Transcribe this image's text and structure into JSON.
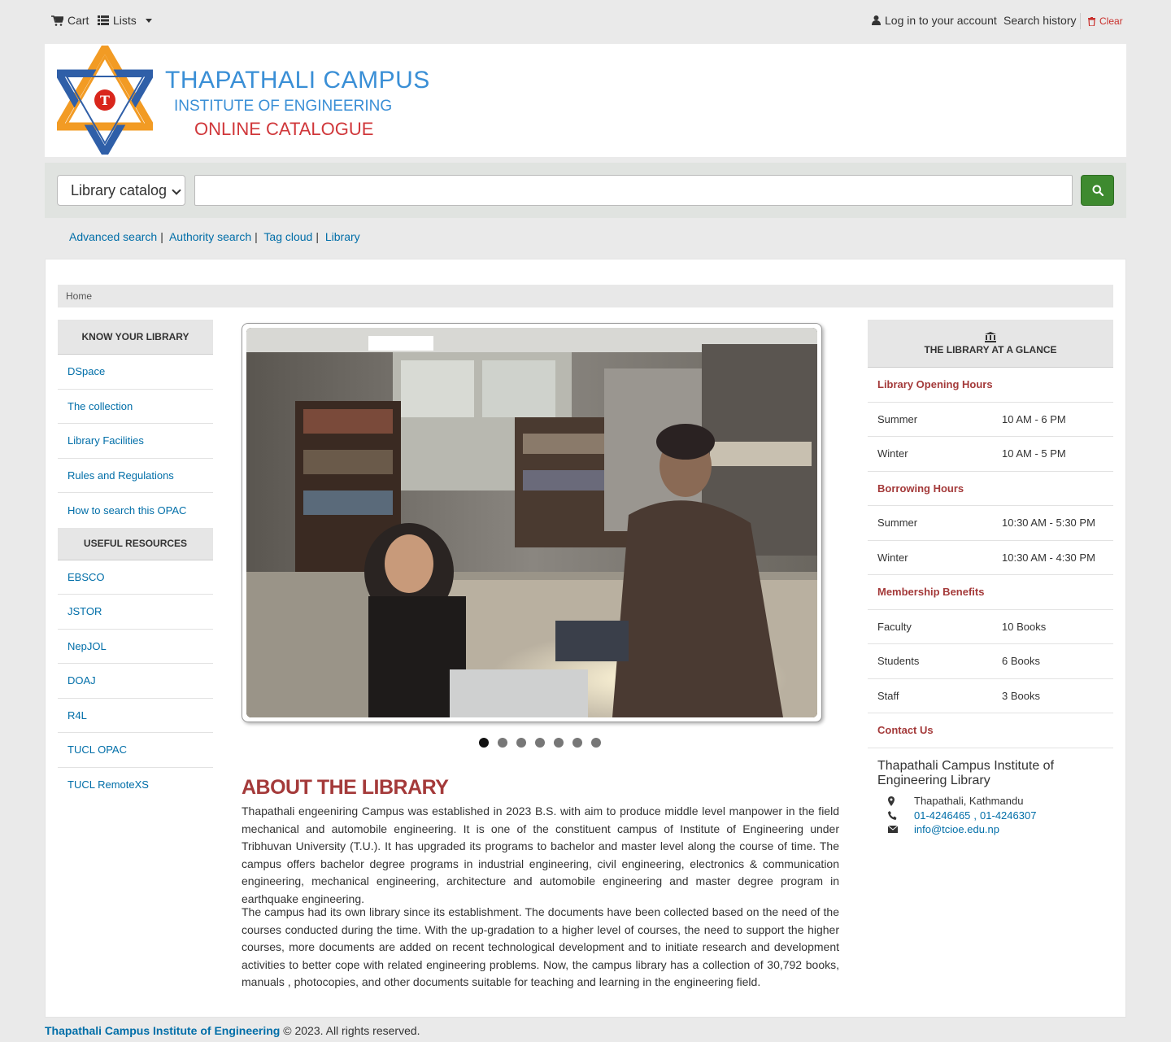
{
  "topbar": {
    "cart": "Cart",
    "lists": "Lists",
    "login": "Log in to your account",
    "search_history": "Search history",
    "clear": "Clear"
  },
  "logo": {
    "line1": "THAPATHALI CAMPUS",
    "line2": "INSTITUTE OF ENGINEERING",
    "line3": "ONLINE CATALOGUE",
    "emblem_text": "T"
  },
  "search": {
    "scope_selected": "Library catalog",
    "query_value": "",
    "button_icon": "search-icon"
  },
  "moresearches": {
    "advanced": "Advanced search",
    "authority": "Authority search",
    "tagcloud": "Tag cloud",
    "library": "Library",
    "separator": "|"
  },
  "breadcrumb": {
    "home": "Home"
  },
  "leftnav": {
    "know_heading": "KNOW YOUR LIBRARY",
    "know_items": [
      {
        "label": "DSpace"
      },
      {
        "label": "The collection"
      },
      {
        "label": "Library Facilities"
      },
      {
        "label": "Rules and Regulations"
      },
      {
        "label": "How to search this OPAC"
      }
    ],
    "resources_heading": "USEFUL RESOURCES",
    "resource_items": [
      {
        "label": "EBSCO"
      },
      {
        "label": "JSTOR"
      },
      {
        "label": "NepJOL"
      },
      {
        "label": "DOAJ"
      },
      {
        "label": "R4L"
      },
      {
        "label": "TUCL OPAC"
      },
      {
        "label": "TUCL RemoteXS"
      }
    ]
  },
  "slider": {
    "slide_count": 7,
    "active_slide": 1
  },
  "about": {
    "title": "ABOUT THE LIBRARY",
    "p1": "Thapathali engeeniring Campus was established in 2023 B.S. with aim to produce middle level manpower in the field mechanical and automobile engineering. It is one of the constituent campus of Institute of Engineering under Tribhuvan University (T.U.). It has upgraded its programs to bachelor and master level along the course of time. The campus offers bachelor degree programs in industrial engineering, civil engineering, electronics & communication engineering, mechanical engineering, architecture and automobile engineering and master degree program in earthquake engineering.",
    "p2": "The campus had its own library since its establishment. The documents have been collected based on the need of the courses conducted during the time. With the up-gradation to a higher level of courses, the need to support the higher courses, more documents are added on recent technological development and to initiate research and development activities to better cope with related engineering problems. Now, the campus library has a collection of 30,792 books, manuals , photocopies, and other documents suitable for teaching and learning in the engineering field."
  },
  "glance": {
    "heading": "THE LIBRARY AT A GLANCE",
    "opening_title": "Library Opening Hours",
    "opening": [
      {
        "k": "Summer",
        "v": "10 AM - 6 PM"
      },
      {
        "k": "Winter",
        "v": "10 AM - 5 PM"
      }
    ],
    "borrowing_title": "Borrowing Hours",
    "borrowing": [
      {
        "k": "Summer",
        "v": "10:30 AM - 5:30 PM"
      },
      {
        "k": "Winter",
        "v": "10:30 AM - 4:30 PM"
      }
    ],
    "membership_title": "Membership Benefits",
    "membership": [
      {
        "k": "Faculty",
        "v": "10 Books"
      },
      {
        "k": "Students",
        "v": "6 Books"
      },
      {
        "k": "Staff",
        "v": "3 Books"
      }
    ],
    "contact_title": "Contact Us",
    "contact_name": "Thapathali Campus Institute of Engineering Library",
    "address": "Thapathali, Kathmandu",
    "phone1": "01-4246465",
    "phone_sep": ",",
    "phone2": "01-4246307",
    "email": "info@tcioe.edu.np"
  },
  "footer": {
    "org": "Thapathali Campus Institute of Engineering",
    "rights": "© 2023. All rights reserved."
  },
  "colors": {
    "link": "#006ea8",
    "accent_red": "#a43a3a",
    "search_button": "#3e8a2f",
    "logo_blue": "#3a8fd6",
    "logo_red": "#d0373a"
  }
}
